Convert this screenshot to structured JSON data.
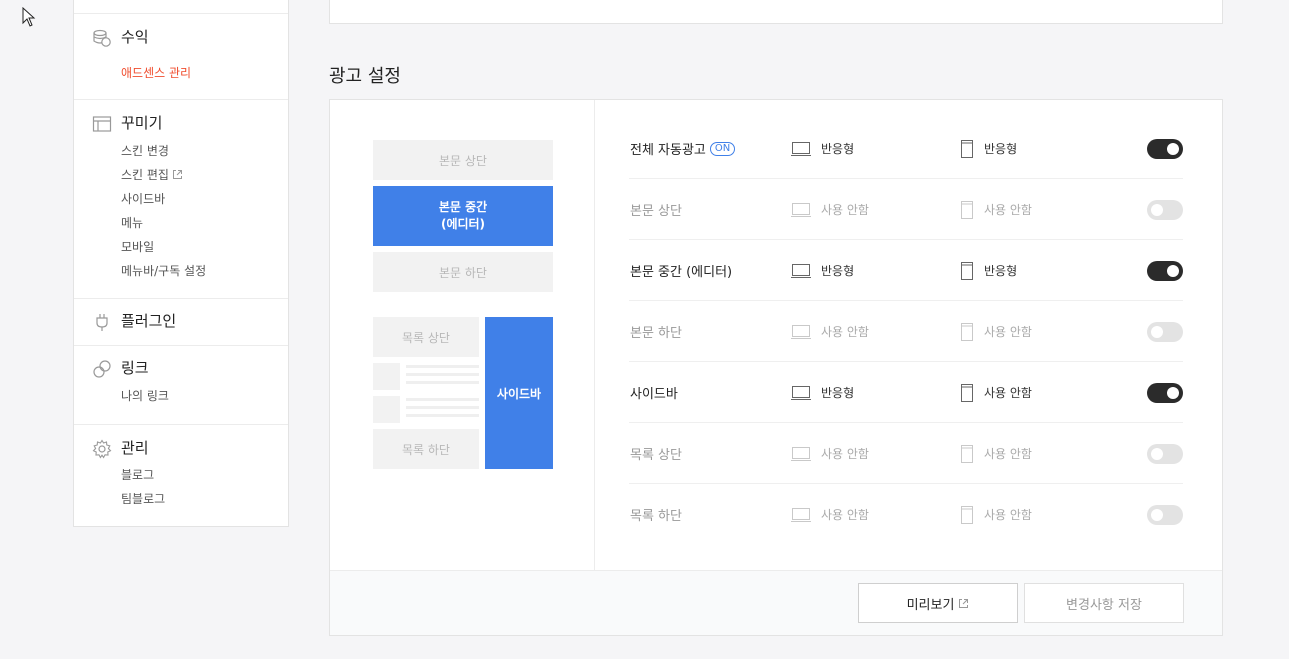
{
  "sidebar": {
    "revenue": {
      "title": "수익",
      "icon": "coins-icon",
      "items": [
        {
          "label": "애드센스 관리",
          "active": true
        }
      ]
    },
    "design": {
      "title": "꾸미기",
      "icon": "layout-icon",
      "items": [
        {
          "label": "스킨 변경"
        },
        {
          "label": "스킨 편집",
          "external": true
        },
        {
          "label": "사이드바"
        },
        {
          "label": "메뉴"
        },
        {
          "label": "모바일"
        },
        {
          "label": "메뉴바/구독 설정"
        }
      ]
    },
    "plugin": {
      "title": "플러그인",
      "icon": "plug-icon"
    },
    "link": {
      "title": "링크",
      "icon": "link-icon",
      "items": [
        {
          "label": "나의 링크"
        }
      ]
    },
    "manage": {
      "title": "관리",
      "icon": "gear-icon",
      "items": [
        {
          "label": "블로그"
        },
        {
          "label": "팀블로그"
        }
      ]
    }
  },
  "main": {
    "title": "광고 설정",
    "preview": {
      "top": "본문 상단",
      "middle": "본문 중간\n(에디터)",
      "bottom": "본문 하단",
      "list_top": "목록 상단",
      "list_bottom": "목록 하단",
      "sidebar": "사이드바"
    },
    "rows": [
      {
        "label": "전체 자동광고",
        "badge": "ON",
        "pc": "반응형",
        "mobile": "반응형",
        "enabled": true
      },
      {
        "label": "본문 상단",
        "pc": "사용 안함",
        "mobile": "사용 안함",
        "enabled": false
      },
      {
        "label": "본문 중간 (에디터)",
        "pc": "반응형",
        "mobile": "반응형",
        "enabled": true
      },
      {
        "label": "본문 하단",
        "pc": "사용 안함",
        "mobile": "사용 안함",
        "enabled": false
      },
      {
        "label": "사이드바",
        "pc": "반응형",
        "mobile": "사용 안함",
        "enabled": true
      },
      {
        "label": "목록 상단",
        "pc": "사용 안함",
        "mobile": "사용 안함",
        "enabled": false
      },
      {
        "label": "목록 하단",
        "pc": "사용 안함",
        "mobile": "사용 안함",
        "enabled": false
      }
    ],
    "buttons": {
      "preview": "미리보기",
      "save": "변경사항 저장"
    }
  },
  "colors": {
    "accent_blue": "#4080e8",
    "active_red": "#f04e2f",
    "toggle_on": "#2b2b2b",
    "toggle_off": "#e3e3e3"
  }
}
